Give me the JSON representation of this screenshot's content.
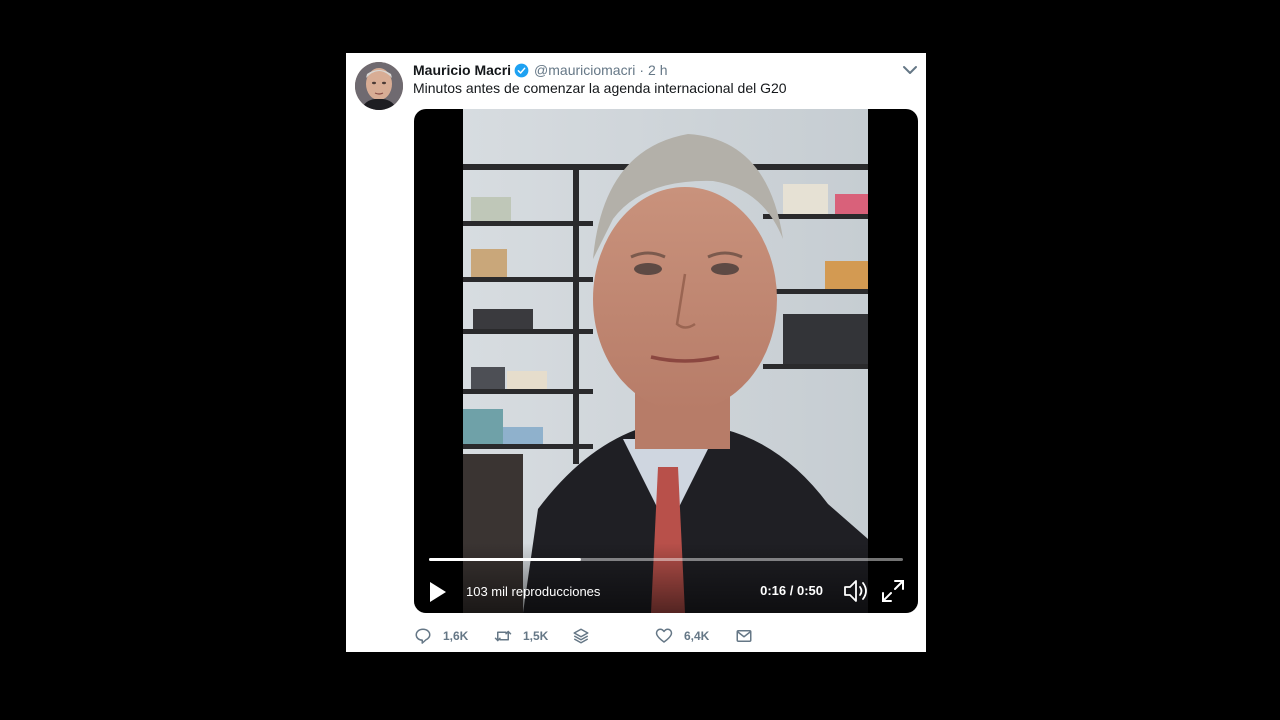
{
  "tweet": {
    "author_name": "Mauricio Macri",
    "handle": "@mauriciomacri",
    "separator": "·",
    "time": "2 h",
    "text": "Minutos antes de comenzar la agenda internacional del G20"
  },
  "video": {
    "views": "103 mil reproducciones",
    "time_display": "0:16 / 0:50",
    "progress": 0.32
  },
  "actions": {
    "replies": "1,6K",
    "retweets": "1,5K",
    "likes": "6,4K"
  },
  "colors": {
    "text": "#14171a",
    "secondary": "#657786",
    "verified": "#1da1f2",
    "background": "#000000"
  },
  "icons": {
    "verified": "verified-badge-icon",
    "caret": "chevron-down-icon",
    "play": "play-icon",
    "volume": "volume-icon",
    "fullscreen": "fullscreen-icon",
    "reply": "reply-icon",
    "retweet": "retweet-icon",
    "layers": "stack-icon",
    "like": "heart-icon",
    "message": "envelope-icon"
  }
}
